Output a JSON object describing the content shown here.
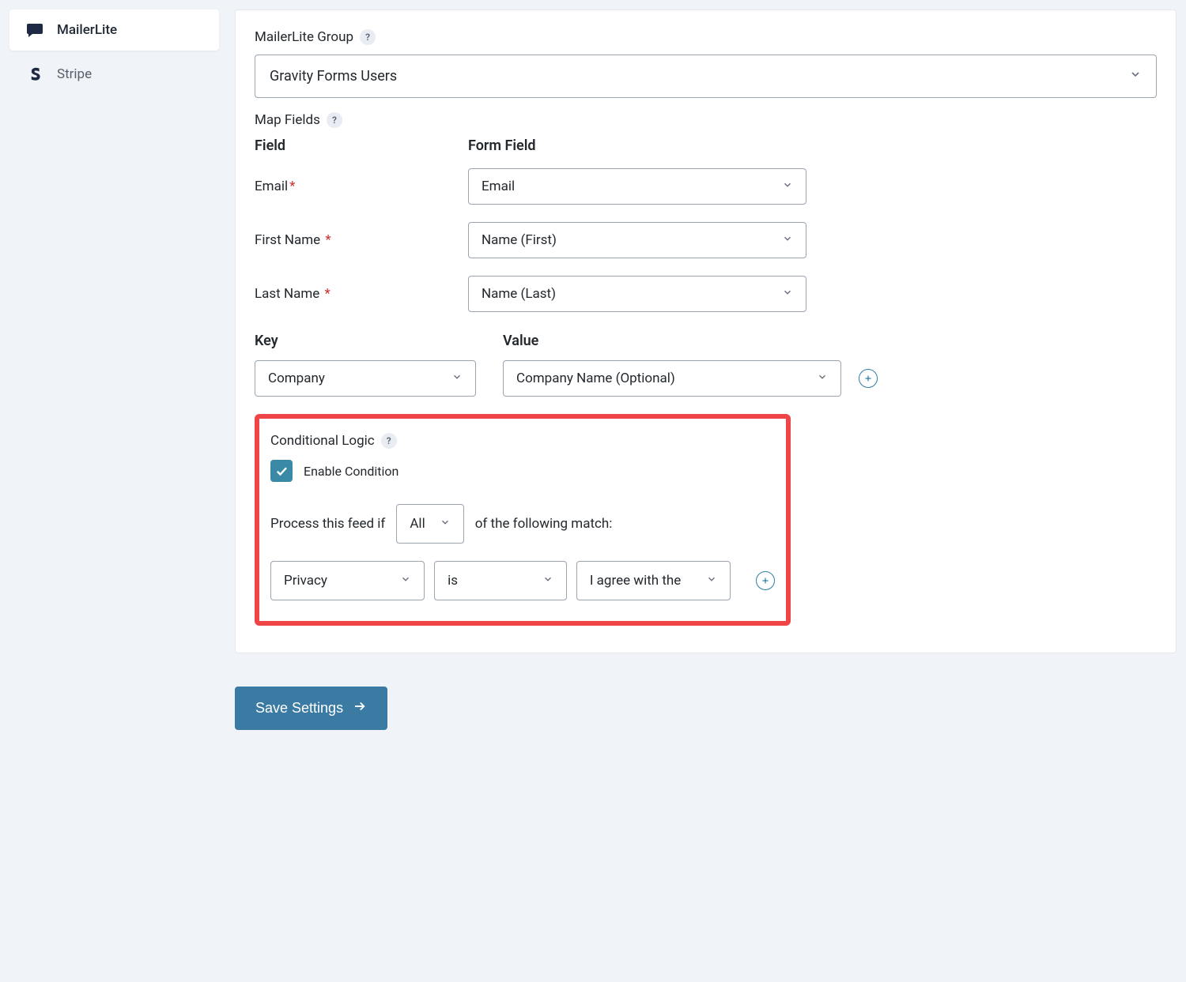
{
  "sidebar": {
    "items": [
      {
        "label": "MailerLite",
        "icon": "chat-icon",
        "active": true
      },
      {
        "label": "Stripe",
        "icon": "stripe-icon",
        "active": false
      }
    ]
  },
  "main": {
    "group_label": "MailerLite Group",
    "group_value": "Gravity Forms Users",
    "map_fields_label": "Map Fields",
    "field_header": "Field",
    "form_field_header": "Form Field",
    "map_rows": [
      {
        "label": "Email",
        "required": true,
        "value": "Email"
      },
      {
        "label": "First Name",
        "required": true,
        "value": "Name (First)"
      },
      {
        "label": "Last Name",
        "required": true,
        "value": "Name (Last)"
      }
    ],
    "key_header": "Key",
    "value_header": "Value",
    "kv_rows": [
      {
        "key": "Company",
        "value": "Company Name (Optional)"
      }
    ],
    "conditional": {
      "title": "Conditional Logic",
      "enable_label": "Enable Condition",
      "enabled": true,
      "pre_text": "Process this feed if",
      "mode": "All",
      "post_text": "of the following match:",
      "rule": {
        "field": "Privacy",
        "operator": "is",
        "value": "I agree with the"
      }
    },
    "save_label": "Save Settings"
  },
  "glyphs": {
    "help": "?",
    "required": "*",
    "plus": "+"
  }
}
